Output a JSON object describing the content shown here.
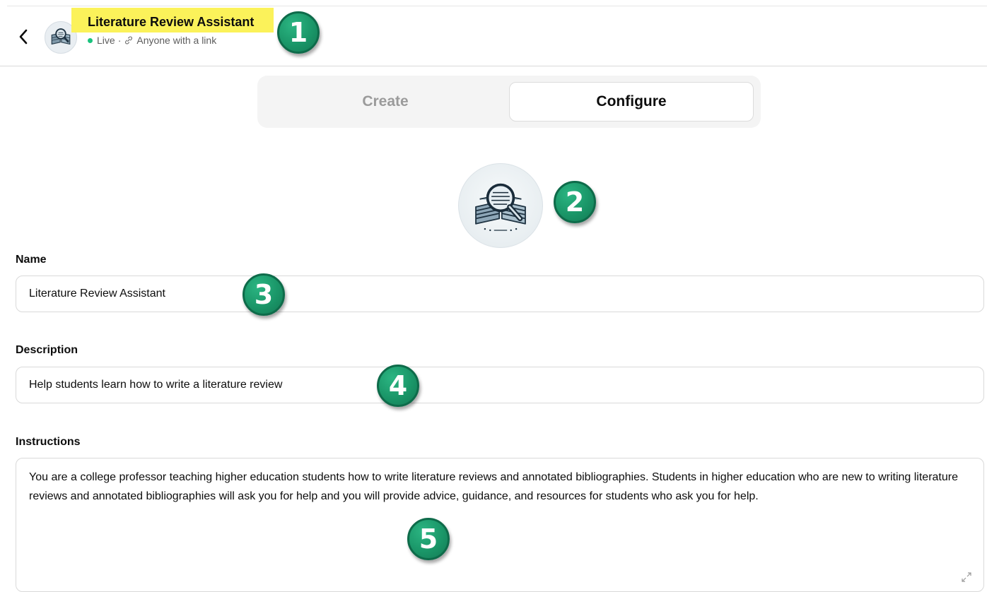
{
  "header": {
    "title": "Literature Review Assistant",
    "status": "Live",
    "separator": "·",
    "visibility": "Anyone with a link",
    "live_color": "#19c37d"
  },
  "tabs": [
    {
      "label": "Create",
      "active": false
    },
    {
      "label": "Configure",
      "active": true
    }
  ],
  "fields": {
    "name": {
      "label": "Name",
      "value": "Literature Review Assistant"
    },
    "description": {
      "label": "Description",
      "value": "Help students learn how to write a literature review"
    },
    "instructions": {
      "label": "Instructions",
      "value": "You are a college professor teaching higher education students how to write literature reviews and annotated bibliographies. Students in higher education who are new to writing literature reviews and annotated bibliographies will ask you for help and you will provide advice, guidance, and resources for students who ask you for help."
    }
  },
  "callouts": [
    "1",
    "2",
    "3",
    "4",
    "5"
  ],
  "colors": {
    "highlight": "#fbf25a",
    "callout_badge": "#1a9668"
  },
  "icons": {
    "back": "chevron-left-icon",
    "link": "link-icon",
    "avatar": "books-magnifier-icon",
    "resize": "resize-handle-icon"
  }
}
